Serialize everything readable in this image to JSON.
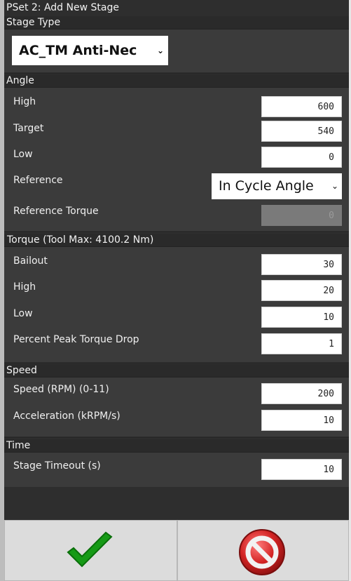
{
  "dialog": {
    "title": "PSet 2: Add New Stage"
  },
  "stage_type": {
    "title": "Stage Type",
    "selected": "AC_TM Anti-Nec"
  },
  "angle": {
    "title": "Angle",
    "high_label": "High",
    "high_value": "600",
    "target_label": "Target",
    "target_value": "540",
    "low_label": "Low",
    "low_value": "0",
    "reference_label": "Reference",
    "reference_selected": "In Cycle Angle",
    "reference_torque_label": "Reference Torque",
    "reference_torque_value": "0"
  },
  "torque": {
    "title": "Torque (Tool Max: 4100.2 Nm)",
    "bailout_label": "Bailout",
    "bailout_value": "30",
    "high_label": "High",
    "high_value": "20",
    "low_label": "Low",
    "low_value": "10",
    "peak_drop_label": "Percent Peak Torque Drop",
    "peak_drop_value": "1"
  },
  "speed": {
    "title": "Speed",
    "rpm_label": "Speed (RPM) (0-11)",
    "rpm_value": "200",
    "accel_label": "Acceleration (kRPM/s)",
    "accel_value": "10"
  },
  "time": {
    "title": "Time",
    "timeout_label": "Stage Timeout (s)",
    "timeout_value": "10"
  },
  "actions": {
    "confirm_icon": "checkmark-icon",
    "cancel_icon": "cancel-icon",
    "colors": {
      "confirm_green": "#1e9e1e",
      "cancel_red": "#c41e1e"
    }
  }
}
